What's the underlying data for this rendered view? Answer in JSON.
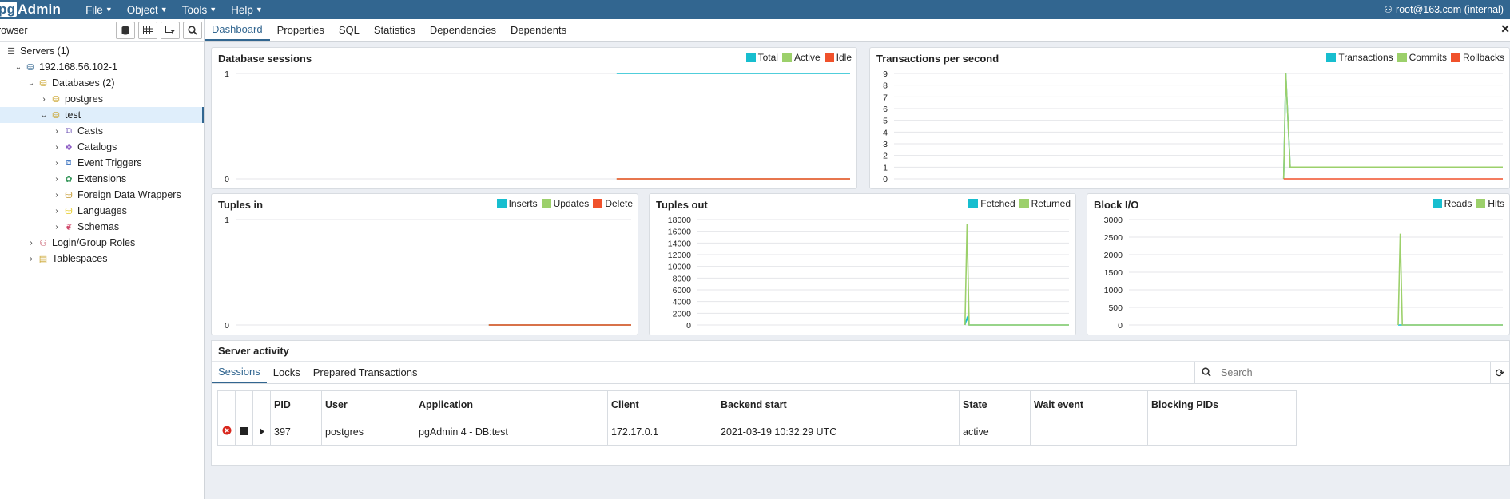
{
  "navbar": {
    "brand_prefix": "pg",
    "brand_rest": "Admin",
    "menus": [
      "File",
      "Object",
      "Tools",
      "Help"
    ],
    "user": "root@163.com (internal)"
  },
  "browser": {
    "title": "rowser",
    "tree": [
      {
        "label": "Servers (1)",
        "level": 0,
        "chevron": "",
        "icon": "servers-icon"
      },
      {
        "label": "192.168.56.102-1",
        "level": 1,
        "chevron": "v",
        "icon": "elephant-icon"
      },
      {
        "label": "Databases (2)",
        "level": 2,
        "chevron": "v",
        "icon": "databases-icon"
      },
      {
        "label": "postgres",
        "level": 3,
        "chevron": ">",
        "icon": "database-icon"
      },
      {
        "label": "test",
        "level": 3,
        "chevron": "v",
        "icon": "database-icon",
        "selected": true
      },
      {
        "label": "Casts",
        "level": 4,
        "chevron": ">",
        "icon": "casts-icon"
      },
      {
        "label": "Catalogs",
        "level": 4,
        "chevron": ">",
        "icon": "catalogs-icon"
      },
      {
        "label": "Event Triggers",
        "level": 4,
        "chevron": ">",
        "icon": "event-triggers-icon"
      },
      {
        "label": "Extensions",
        "level": 4,
        "chevron": ">",
        "icon": "extensions-icon"
      },
      {
        "label": "Foreign Data Wrappers",
        "level": 4,
        "chevron": ">",
        "icon": "fdw-icon"
      },
      {
        "label": "Languages",
        "level": 4,
        "chevron": ">",
        "icon": "languages-icon"
      },
      {
        "label": "Schemas",
        "level": 4,
        "chevron": ">",
        "icon": "schemas-icon"
      },
      {
        "label": "Login/Group Roles",
        "level": 2,
        "chevron": ">",
        "icon": "roles-icon"
      },
      {
        "label": "Tablespaces",
        "level": 2,
        "chevron": ">",
        "icon": "tablespaces-icon"
      }
    ]
  },
  "tabs": [
    "Dashboard",
    "Properties",
    "SQL",
    "Statistics",
    "Dependencies",
    "Dependents"
  ],
  "colors": {
    "cyan": "#17becf",
    "green": "#9cd06b",
    "red": "#f0512b",
    "accent": "#326690"
  },
  "chart_data": [
    {
      "type": "line",
      "title": "Database sessions",
      "legend": [
        "Total",
        "Active",
        "Idle"
      ],
      "ylim": [
        0,
        1
      ],
      "yticks": [
        "0",
        "1"
      ],
      "series": [
        {
          "name": "Total",
          "values": [
            1,
            1
          ]
        },
        {
          "name": "Active",
          "values": [
            0,
            0
          ]
        },
        {
          "name": "Idle",
          "values": [
            0,
            0
          ]
        }
      ]
    },
    {
      "type": "line",
      "title": "Transactions per second",
      "legend": [
        "Transactions",
        "Commits",
        "Rollbacks"
      ],
      "ylim": [
        0,
        9
      ],
      "yticks": [
        "0",
        "1",
        "2",
        "3",
        "4",
        "5",
        "6",
        "7",
        "8",
        "9"
      ],
      "series": [
        {
          "name": "Transactions",
          "values": [
            0,
            9,
            1,
            1,
            1,
            1,
            1
          ]
        },
        {
          "name": "Commits",
          "values": [
            0,
            9,
            1,
            1,
            1,
            1,
            1
          ]
        },
        {
          "name": "Rollbacks",
          "values": [
            0,
            0,
            0,
            0,
            0,
            0,
            0
          ]
        }
      ]
    },
    {
      "type": "line",
      "title": "Tuples in",
      "legend": [
        "Inserts",
        "Updates",
        "Delete"
      ],
      "ylim": [
        0,
        1
      ],
      "yticks": [
        "0",
        "1"
      ],
      "series": [
        {
          "name": "Inserts",
          "values": [
            0,
            0
          ]
        },
        {
          "name": "Updates",
          "values": [
            0,
            0
          ]
        },
        {
          "name": "Delete",
          "values": [
            0,
            0
          ]
        }
      ]
    },
    {
      "type": "line",
      "title": "Tuples out",
      "legend": [
        "Fetched",
        "Returned"
      ],
      "ylim": [
        0,
        18000
      ],
      "yticks": [
        "0",
        "2000",
        "4000",
        "6000",
        "8000",
        "10000",
        "12000",
        "14000",
        "16000",
        "18000"
      ],
      "series": [
        {
          "name": "Fetched",
          "values": [
            0,
            1200,
            0,
            0,
            0,
            0,
            0
          ]
        },
        {
          "name": "Returned",
          "values": [
            0,
            17200,
            0,
            0,
            0,
            0,
            0
          ]
        }
      ]
    },
    {
      "type": "line",
      "title": "Block I/O",
      "legend": [
        "Reads",
        "Hits"
      ],
      "ylim": [
        0,
        3000
      ],
      "yticks": [
        "0",
        "500",
        "1000",
        "1500",
        "2000",
        "2500",
        "3000"
      ],
      "series": [
        {
          "name": "Reads",
          "values": [
            0,
            0,
            0,
            0,
            0,
            0,
            0
          ]
        },
        {
          "name": "Hits",
          "values": [
            0,
            2600,
            0,
            0,
            0,
            0,
            0
          ]
        }
      ]
    }
  ],
  "activity": {
    "title": "Server activity",
    "tabs": [
      "Sessions",
      "Locks",
      "Prepared Transactions"
    ],
    "search_placeholder": "Search",
    "columns": [
      "PID",
      "User",
      "Application",
      "Client",
      "Backend start",
      "State",
      "Wait event",
      "Blocking PIDs"
    ],
    "rows": [
      [
        "397",
        "postgres",
        "pgAdmin 4 - DB:test",
        "172.17.0.1",
        "2021-03-19 10:32:29 UTC",
        "active",
        "",
        ""
      ]
    ]
  }
}
